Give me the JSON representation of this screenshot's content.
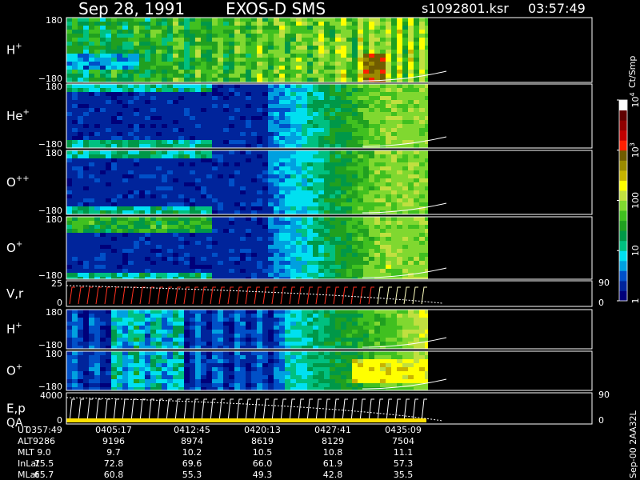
{
  "chart_data": {
    "type": "heatmap",
    "header": {
      "date": "Sep 28, 1991",
      "instrument": "EXOS-D SMS",
      "file": "s1092801.ksr",
      "time": "03:57:49"
    },
    "panels": [
      {
        "id": "h1",
        "label": "H",
        "sup": "+",
        "ytop": "180",
        "ybot": "−180",
        "right": "",
        "rightBottom": ""
      },
      {
        "id": "he",
        "label": "He",
        "sup": "+",
        "ytop": "180",
        "ybot": "−180",
        "right": "",
        "rightBottom": ""
      },
      {
        "id": "o2",
        "label": "O",
        "sup": "++",
        "ytop": "180",
        "ybot": "−180",
        "right": "",
        "rightBottom": ""
      },
      {
        "id": "o1",
        "label": "O",
        "sup": "+",
        "ytop": "180",
        "ybot": "−180",
        "right": "",
        "rightBottom": ""
      },
      {
        "id": "vr",
        "label": "V,r",
        "sup": "",
        "ytop": "25",
        "ybot": "0",
        "right": "90",
        "rightBottom": "0"
      },
      {
        "id": "h2",
        "label": "H",
        "sup": "+",
        "ytop": "180",
        "ybot": "−180",
        "right": "",
        "rightBottom": ""
      },
      {
        "id": "o3",
        "label": "O",
        "sup": "+",
        "ytop": "180",
        "ybot": "−180",
        "right": "",
        "rightBottom": ""
      },
      {
        "id": "ep",
        "label": "E,p",
        "sup": "",
        "label2": "QA",
        "ytop": "4000",
        "ybot": "0",
        "right": "90",
        "rightBottom": "0"
      }
    ],
    "colorbar": {
      "unit": "Ct/Smp",
      "ticks": [
        {
          "v": 1,
          "label": "1",
          "sup": ""
        },
        {
          "v": 10,
          "label": "10",
          "sup": ""
        },
        {
          "v": 100,
          "label": "100",
          "sup": ""
        },
        {
          "v": 1000,
          "label": "10",
          "sup": "3"
        },
        {
          "v": 10000,
          "label": "10",
          "sup": "4"
        }
      ],
      "colors": [
        "#00007a",
        "#00249b",
        "#0050c8",
        "#00a0e0",
        "#00e0f0",
        "#00c080",
        "#009848",
        "#20a020",
        "#40c020",
        "#80d830",
        "#c0e040",
        "#ffff00",
        "#c8b400",
        "#9a8a00",
        "#705c00",
        "#ff2000",
        "#c00000",
        "#900000",
        "#600000",
        "#ffffff"
      ]
    },
    "time_table": {
      "rows": [
        {
          "label": "UT",
          "values": [
            "0357:49",
            "0405:17",
            "0412:45",
            "0420:13",
            "0427:41",
            "0435:09"
          ]
        },
        {
          "label": "ALT",
          "values": [
            "9286",
            "9196",
            "8974",
            "8619",
            "8129",
            "7504"
          ]
        },
        {
          "label": "MLT",
          "values": [
            "9.0",
            "9.7",
            "10.2",
            "10.5",
            "10.8",
            "11.1"
          ]
        },
        {
          "label": "InLat",
          "values": [
            "75.5",
            "72.8",
            "69.6",
            "66.0",
            "61.9",
            "57.3"
          ]
        },
        {
          "label": "MLat",
          "values": [
            "65.7",
            "60.8",
            "55.3",
            "49.3",
            "42.8",
            "35.5"
          ]
        }
      ]
    },
    "footer_id": "Sep-00 2AA32L"
  }
}
